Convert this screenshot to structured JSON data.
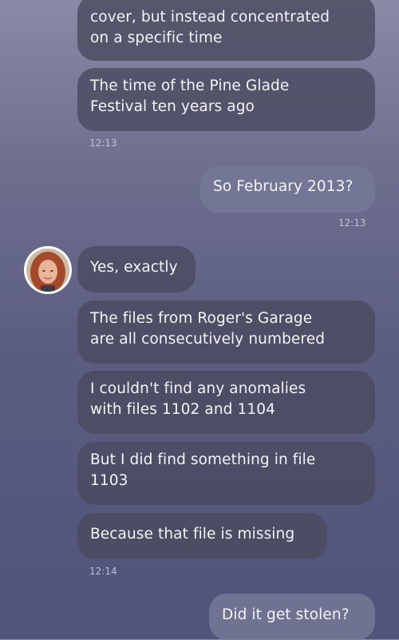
{
  "conversation": {
    "messages": [
      {
        "text": "cover, but instead concentrated\non a specific time"
      },
      {
        "text": "The time of the Pine Glade\nFestival ten years ago"
      },
      {
        "text": "So February 2013?"
      },
      {
        "text": "Yes, exactly"
      },
      {
        "text": "The files from Roger's Garage\nare all consecutively numbered"
      },
      {
        "text": "I couldn't find any anomalies\nwith files 1102 and 1104"
      },
      {
        "text": "But I did find something in file\n1103"
      },
      {
        "text": "Because that file is missing"
      },
      {
        "text": "Did it get stolen?"
      }
    ],
    "timestamps": [
      "12:13",
      "12:13",
      "12:14"
    ]
  },
  "avatar": {
    "icon": "contact-avatar-red-hair-woman"
  },
  "colors": {
    "background_top": "#8a8aa6",
    "background_bottom": "#50537a",
    "incoming_bubble": "#4a4a60",
    "outgoing_bubble": "#767896",
    "text": "#f4f4f8"
  }
}
